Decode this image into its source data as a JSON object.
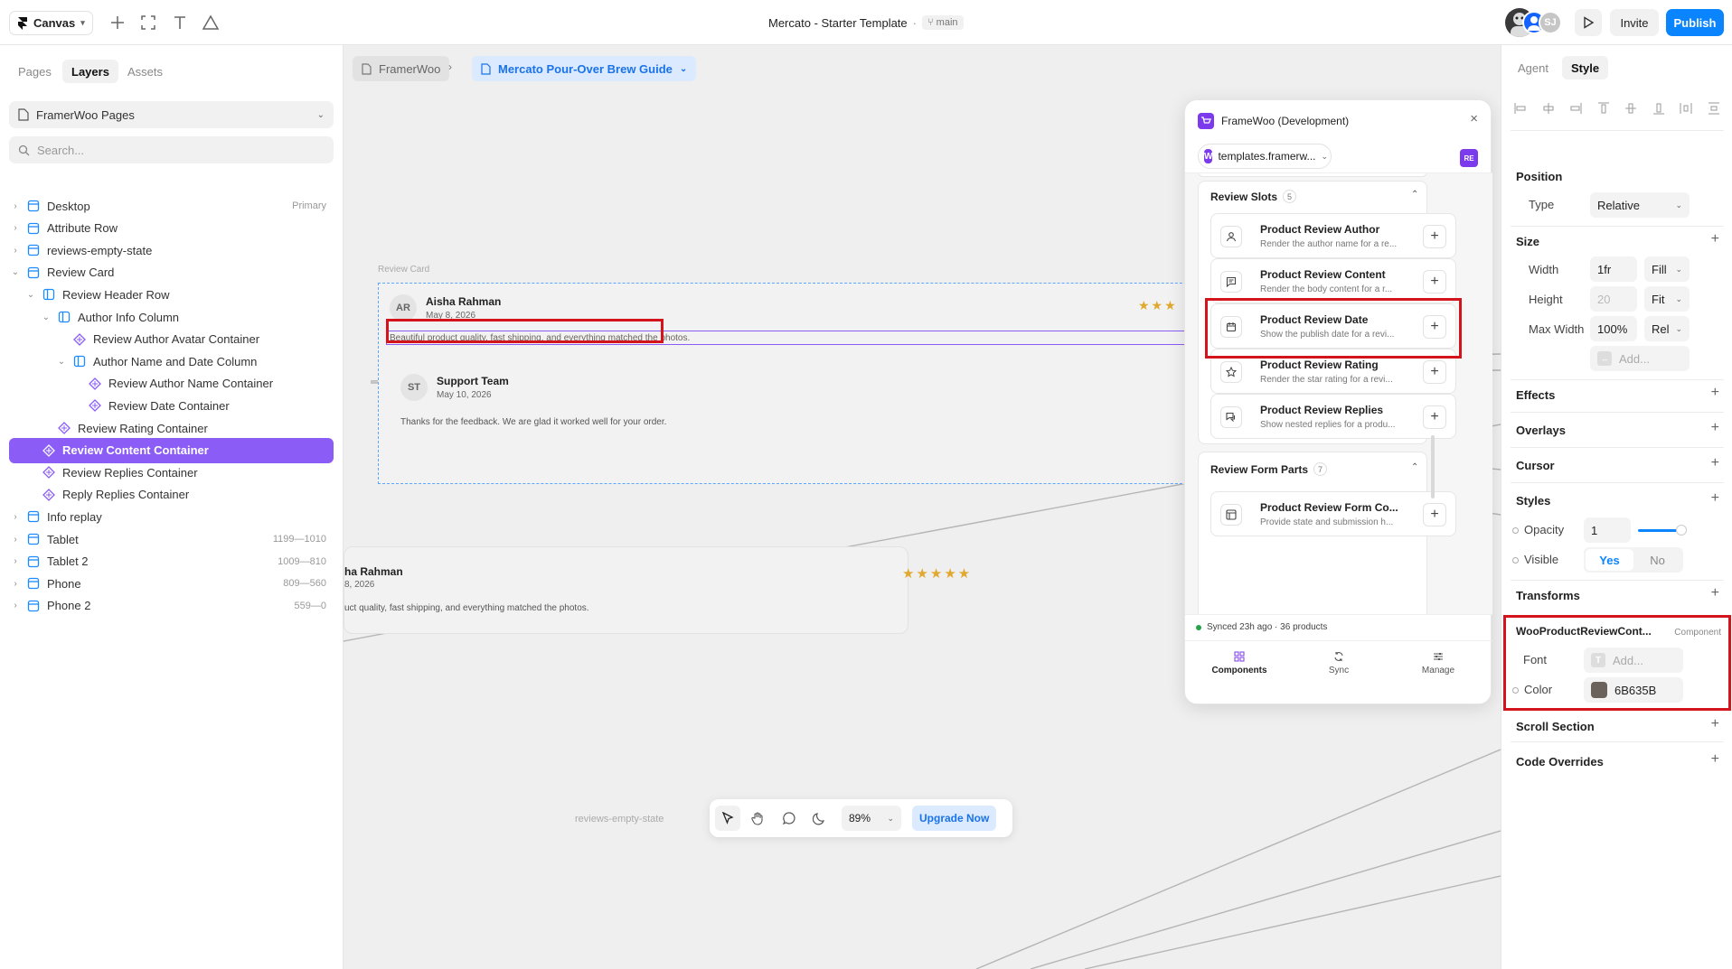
{
  "topbar": {
    "canvas_label": "Canvas",
    "title": "Mercato - Starter Template",
    "title_separator": "·",
    "branch": "main",
    "avatar_initials": "SJ",
    "invite_label": "Invite",
    "publish_label": "Publish"
  },
  "left_panel": {
    "tabs": [
      "Pages",
      "Layers",
      "Assets"
    ],
    "active_tab": "Layers",
    "pages_selector": "FramerWoo Pages",
    "search_placeholder": "Search...",
    "layers": [
      {
        "label": "Desktop",
        "meta": "Primary",
        "depth": 0,
        "icon": "frame-icon",
        "expanded": false
      },
      {
        "label": "Attribute Row",
        "meta": "",
        "depth": 0,
        "icon": "frame-icon",
        "expanded": false
      },
      {
        "label": "reviews-empty-state",
        "meta": "",
        "depth": 0,
        "icon": "frame-icon",
        "expanded": false
      },
      {
        "label": "Review Card",
        "meta": "",
        "depth": 0,
        "icon": "frame-icon",
        "expanded": true
      },
      {
        "label": "Review Header Row",
        "meta": "",
        "depth": 1,
        "icon": "stack-icon",
        "expanded": true
      },
      {
        "label": "Author Info Column",
        "meta": "",
        "depth": 2,
        "icon": "stack-icon",
        "expanded": true
      },
      {
        "label": "Review Author Avatar Container",
        "meta": "",
        "depth": 3,
        "icon": "component-icon",
        "expanded": null
      },
      {
        "label": "Author Name and Date Column",
        "meta": "",
        "depth": 3,
        "icon": "stack-icon",
        "expanded": true
      },
      {
        "label": "Review Author Name Container",
        "meta": "",
        "depth": 4,
        "icon": "component-icon",
        "expanded": null
      },
      {
        "label": "Review Date Container",
        "meta": "",
        "depth": 4,
        "icon": "component-icon",
        "expanded": null
      },
      {
        "label": "Review Rating Container",
        "meta": "",
        "depth": 2,
        "icon": "component-icon",
        "expanded": null
      },
      {
        "label": "Review Content Container",
        "meta": "",
        "depth": 1,
        "icon": "component-icon",
        "expanded": null,
        "selected": true
      },
      {
        "label": "Review Replies Container",
        "meta": "",
        "depth": 1,
        "icon": "component-icon",
        "expanded": null
      },
      {
        "label": "Reply Replies Container",
        "meta": "",
        "depth": 1,
        "icon": "component-icon",
        "expanded": null
      },
      {
        "label": "Info replay",
        "meta": "",
        "depth": 0,
        "icon": "frame-icon",
        "expanded": false
      },
      {
        "label": "Tablet",
        "meta": "1199—1010",
        "depth": 0,
        "icon": "frame-icon",
        "expanded": false
      },
      {
        "label": "Tablet 2",
        "meta": "1009—810",
        "depth": 0,
        "icon": "frame-icon",
        "expanded": false
      },
      {
        "label": "Phone",
        "meta": "809—560",
        "depth": 0,
        "icon": "frame-icon",
        "expanded": false
      },
      {
        "label": "Phone 2",
        "meta": "559—0",
        "depth": 0,
        "icon": "frame-icon",
        "expanded": false
      }
    ]
  },
  "canvas": {
    "breadcrumb_root": "FramerWoo",
    "breadcrumb_page": "Mercato Pour-Over Brew Guide",
    "frame_label": "Review Card",
    "review": {
      "avatar": "AR",
      "author": "Aisha Rahman",
      "date": "May 8, 2026",
      "content": "Beautiful product quality, fast shipping, and everything matched the photos.",
      "stars": "★★★",
      "reply_avatar": "ST",
      "reply_author": "Support Team",
      "reply_date": "May 10, 2026",
      "reply_content": "Thanks for the feedback. We are glad it worked well for your order."
    },
    "preview": {
      "author": "ha Rahman",
      "date": "8, 2026",
      "content": "uct quality, fast shipping, and everything matched the photos.",
      "stars": "★★★★★"
    },
    "empty_state_label": "reviews-empty-state",
    "toolbar": {
      "zoom": "89%",
      "upgrade_label": "Upgrade Now"
    }
  },
  "plugin": {
    "title": "FrameWoo (Development)",
    "site": "templates.framerw...",
    "site_badge": "RE",
    "section1_title": "Review Slots",
    "section1_count": "5",
    "slots": [
      {
        "title": "Product Review Author",
        "desc": "Render the author name for a re...",
        "icon": "user-icon"
      },
      {
        "title": "Product Review Content",
        "desc": "Render the body content for a r...",
        "icon": "message-icon"
      },
      {
        "title": "Product Review Date",
        "desc": "Show the publish date for a revi...",
        "icon": "calendar-icon"
      },
      {
        "title": "Product Review Rating",
        "desc": "Render the star rating for a revi...",
        "icon": "star-icon"
      },
      {
        "title": "Product Review Replies",
        "desc": "Show nested replies for a produ...",
        "icon": "replies-icon"
      }
    ],
    "section2_title": "Review Form Parts",
    "section2_count": "7",
    "form_slot": {
      "title": "Product Review Form Co...",
      "desc": "Provide state and submission h...",
      "icon": "form-icon"
    },
    "sync_status": "Synced 23h ago · 36 products",
    "footer_tabs": [
      "Components",
      "Sync",
      "Manage"
    ],
    "status_color": "#22a447"
  },
  "right_panel": {
    "tabs": [
      "Agent",
      "Style"
    ],
    "active_tab": "Style",
    "position": {
      "title": "Position",
      "type_label": "Type",
      "type_value": "Relative"
    },
    "size": {
      "title": "Size",
      "width_label": "Width",
      "width_value": "1fr",
      "width_mode": "Fill",
      "height_label": "Height",
      "height_value": "20",
      "height_mode": "Fit",
      "maxwidth_label": "Max Width",
      "maxwidth_value": "100%",
      "maxwidth_mode": "Rel",
      "add_placeholder": "Add..."
    },
    "sections": [
      "Effects",
      "Overlays",
      "Cursor"
    ],
    "styles": {
      "title": "Styles",
      "opacity_label": "Opacity",
      "opacity_value": "1",
      "visible_label": "Visible",
      "visible_yes": "Yes",
      "visible_no": "No"
    },
    "transforms_title": "Transforms",
    "component": {
      "name": "WooProductReviewCont...",
      "badge": "Component",
      "font_label": "Font",
      "font_placeholder": "Add...",
      "color_label": "Color",
      "color_value": "6B635B",
      "color_hex": "#6b635b"
    },
    "scroll_section": "Scroll Section",
    "code_overrides": "Code Overrides"
  },
  "colors": {
    "accent_purple": "#8b5cf6",
    "brand_blue": "#0a84ff",
    "highlight_red": "#d4141c",
    "star_gold": "#e0a82e"
  }
}
